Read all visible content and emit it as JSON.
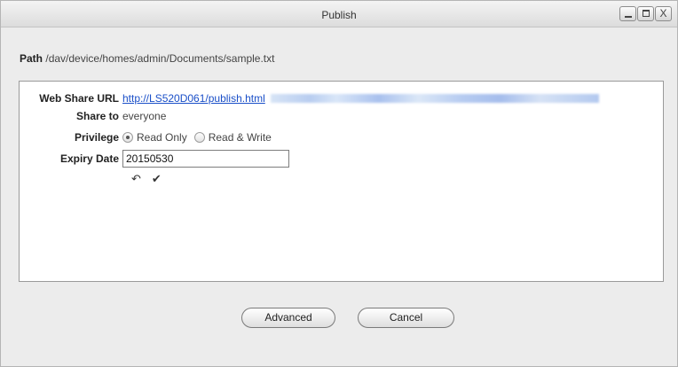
{
  "window": {
    "title": "Publish",
    "controls": {
      "minimize_icon": "minimize-icon",
      "maximize_icon": "maximize-icon",
      "close_label": "X"
    }
  },
  "path": {
    "label": "Path",
    "value": "/dav/device/homes/admin/Documents/sample.txt"
  },
  "form": {
    "web_share_url": {
      "label": "Web Share URL",
      "link": "http://LS520D061/publish.html"
    },
    "share_to": {
      "label": "Share to",
      "value": "everyone"
    },
    "privilege": {
      "label": "Privilege",
      "options": [
        {
          "label": "Read Only",
          "selected": true
        },
        {
          "label": "Read & Write",
          "selected": false
        }
      ]
    },
    "expiry_date": {
      "label": "Expiry Date",
      "value": "20150530"
    },
    "actions": {
      "undo_icon": "undo-arrow-icon",
      "confirm_icon": "checkmark-icon"
    }
  },
  "buttons": {
    "advanced": "Advanced",
    "cancel": "Cancel"
  }
}
